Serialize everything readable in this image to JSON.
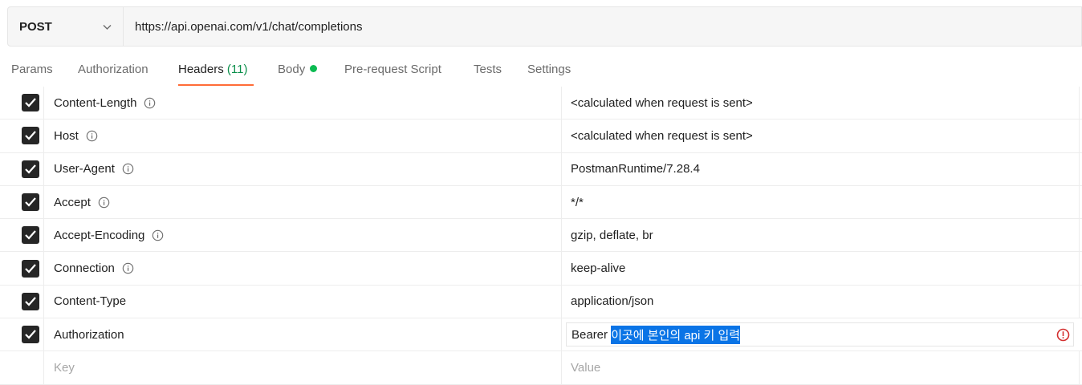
{
  "request": {
    "method": "POST",
    "url": "https://api.openai.com/v1/chat/completions"
  },
  "tabs": [
    {
      "label": "Params"
    },
    {
      "label": "Authorization"
    },
    {
      "label": "Headers",
      "count": "(11)",
      "active": true
    },
    {
      "label": "Body",
      "has_indicator": true
    },
    {
      "label": "Pre-request Script"
    },
    {
      "label": "Tests"
    },
    {
      "label": "Settings"
    }
  ],
  "headers": [
    {
      "key": "Content-Length",
      "value": "<calculated when request is sent>",
      "checked": true,
      "info": true
    },
    {
      "key": "Host",
      "value": "<calculated when request is sent>",
      "checked": true,
      "info": true
    },
    {
      "key": "User-Agent",
      "value": "PostmanRuntime/7.28.4",
      "checked": true,
      "info": true
    },
    {
      "key": "Accept",
      "value": "*/*",
      "checked": true,
      "info": true
    },
    {
      "key": "Accept-Encoding",
      "value": "gzip, deflate, br",
      "checked": true,
      "info": true
    },
    {
      "key": "Connection",
      "value": "keep-alive",
      "checked": true,
      "info": true
    },
    {
      "key": "Content-Type",
      "value": "application/json",
      "checked": true,
      "info": false
    },
    {
      "key": "Authorization",
      "value_prefix": "Bearer ",
      "value_selected": "이곳에 본인의 api 키 입력",
      "checked": true,
      "info": false
    }
  ],
  "new_row": {
    "key_placeholder": "Key",
    "value_placeholder": "Value"
  },
  "colors": {
    "accent": "#ff6c37",
    "count": "#0a8f4a",
    "body_dot": "#0cbb52",
    "selection": "#0a74e6",
    "warning": "#d32f2f"
  }
}
